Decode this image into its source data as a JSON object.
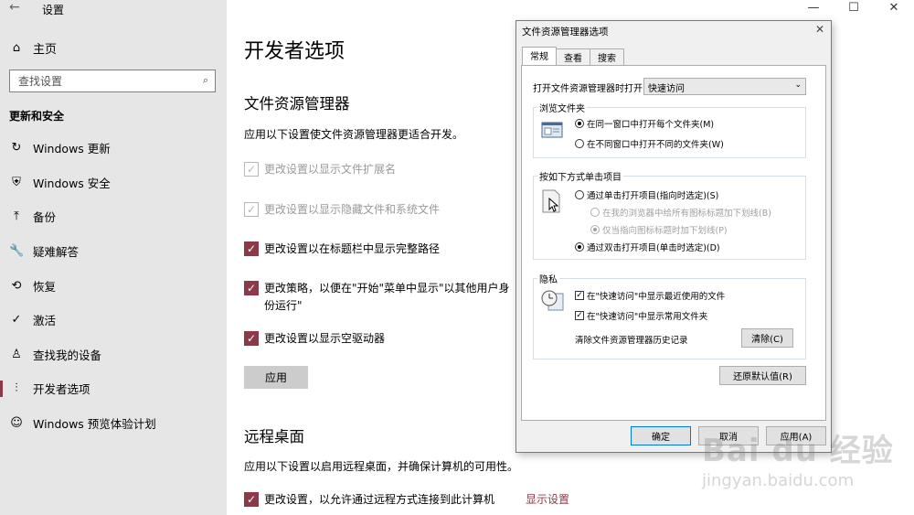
{
  "settings": {
    "back_glyph": "←",
    "app_title": "设置",
    "home": {
      "icon": "home-icon",
      "glyph": "⌂",
      "label": "主页"
    },
    "search": {
      "placeholder": "查找设置",
      "icon": "search-icon",
      "glyph": "⌕"
    },
    "section_title": "更新和安全",
    "nav": [
      {
        "name": "windows-update",
        "icon": "refresh-icon",
        "glyph": "↻",
        "label": "Windows 更新",
        "active": false
      },
      {
        "name": "windows-security",
        "icon": "shield-icon",
        "glyph": "⛨",
        "label": "Windows 安全",
        "active": false
      },
      {
        "name": "backup",
        "icon": "upload-arrow-icon",
        "glyph": "⤒",
        "label": "备份",
        "active": false
      },
      {
        "name": "troubleshoot",
        "icon": "wrench-icon",
        "glyph": "🔧",
        "label": "疑难解答",
        "active": false
      },
      {
        "name": "recovery",
        "icon": "history-icon",
        "glyph": "⟲",
        "label": "恢复",
        "active": false
      },
      {
        "name": "activation",
        "icon": "check-circle-icon",
        "glyph": "✓",
        "label": "激活",
        "active": false
      },
      {
        "name": "find-my-device",
        "icon": "person-pin-icon",
        "glyph": "♙",
        "label": "查找我的设备",
        "active": false
      },
      {
        "name": "for-developers",
        "icon": "developer-icon",
        "glyph": "⫶",
        "label": "开发者选项",
        "active": true
      },
      {
        "name": "windows-insider",
        "icon": "insider-icon",
        "glyph": "☺",
        "label": "Windows 预览体验计划",
        "active": false
      }
    ]
  },
  "main": {
    "window_controls": [
      "—",
      "☐",
      "✕"
    ],
    "page_title": "开发者选项",
    "explorer": {
      "heading": "文件资源管理器",
      "description": "应用以下设置使文件资源管理器更适合开发。",
      "options": [
        {
          "label": "更改设置以显示文件扩展名",
          "checked": true,
          "enabled": false
        },
        {
          "label": "更改设置以显示隐藏文件和系统文件",
          "checked": true,
          "enabled": false
        },
        {
          "label": "更改设置以在标题栏中显示完整路径",
          "checked": true,
          "enabled": true
        },
        {
          "label": "更改策略，以便在\"开始\"菜单中显示\"以其他用户身份运行\"",
          "checked": true,
          "enabled": true
        },
        {
          "label": "更改设置以显示空驱动器",
          "checked": true,
          "enabled": true
        }
      ],
      "apply_label": "应用"
    },
    "remote": {
      "heading": "远程桌面",
      "description": "应用以下设置以启用远程桌面，并确保计算机的可用性。",
      "option_label": "更改设置，以允许通过远程方式连接到此计算机",
      "link_label": "显示设置"
    }
  },
  "dialog": {
    "title": "文件资源管理器选项",
    "close_glyph": "✕",
    "tabs": [
      "常规",
      "查看",
      "搜索"
    ],
    "active_tab": 0,
    "open_label": "打开文件资源管理器时打开:",
    "open_value": "快速访问",
    "browse": {
      "title": "浏览文件夹",
      "options": [
        "在同一窗口中打开每个文件夹(M)",
        "在不同窗口中打开不同的文件夹(W)"
      ],
      "selected": 0
    },
    "click": {
      "title": "按如下方式单击项目",
      "single": "通过单击打开项目(指向时选定)(S)",
      "sub1": "在我的浏览器中给所有图标标题加下划线(B)",
      "sub2": "仅当指向图标标题时加下划线(P)",
      "double": "通过双击打开项目(单击时选定)(D)"
    },
    "privacy": {
      "title": "隐私",
      "options": [
        "在\"快速访问\"中显示最近使用的文件",
        "在\"快速访问\"中显示常用文件夹"
      ],
      "clear_label": "清除文件资源管理器历史记录",
      "clear_button": "清除(C)"
    },
    "restore_button": "还原默认值(R)",
    "buttons": {
      "ok": "确定",
      "cancel": "取消",
      "apply": "应用(A)"
    }
  },
  "watermark": {
    "logo": "Bai du 经验",
    "url": "jingyan.baidu.com"
  }
}
